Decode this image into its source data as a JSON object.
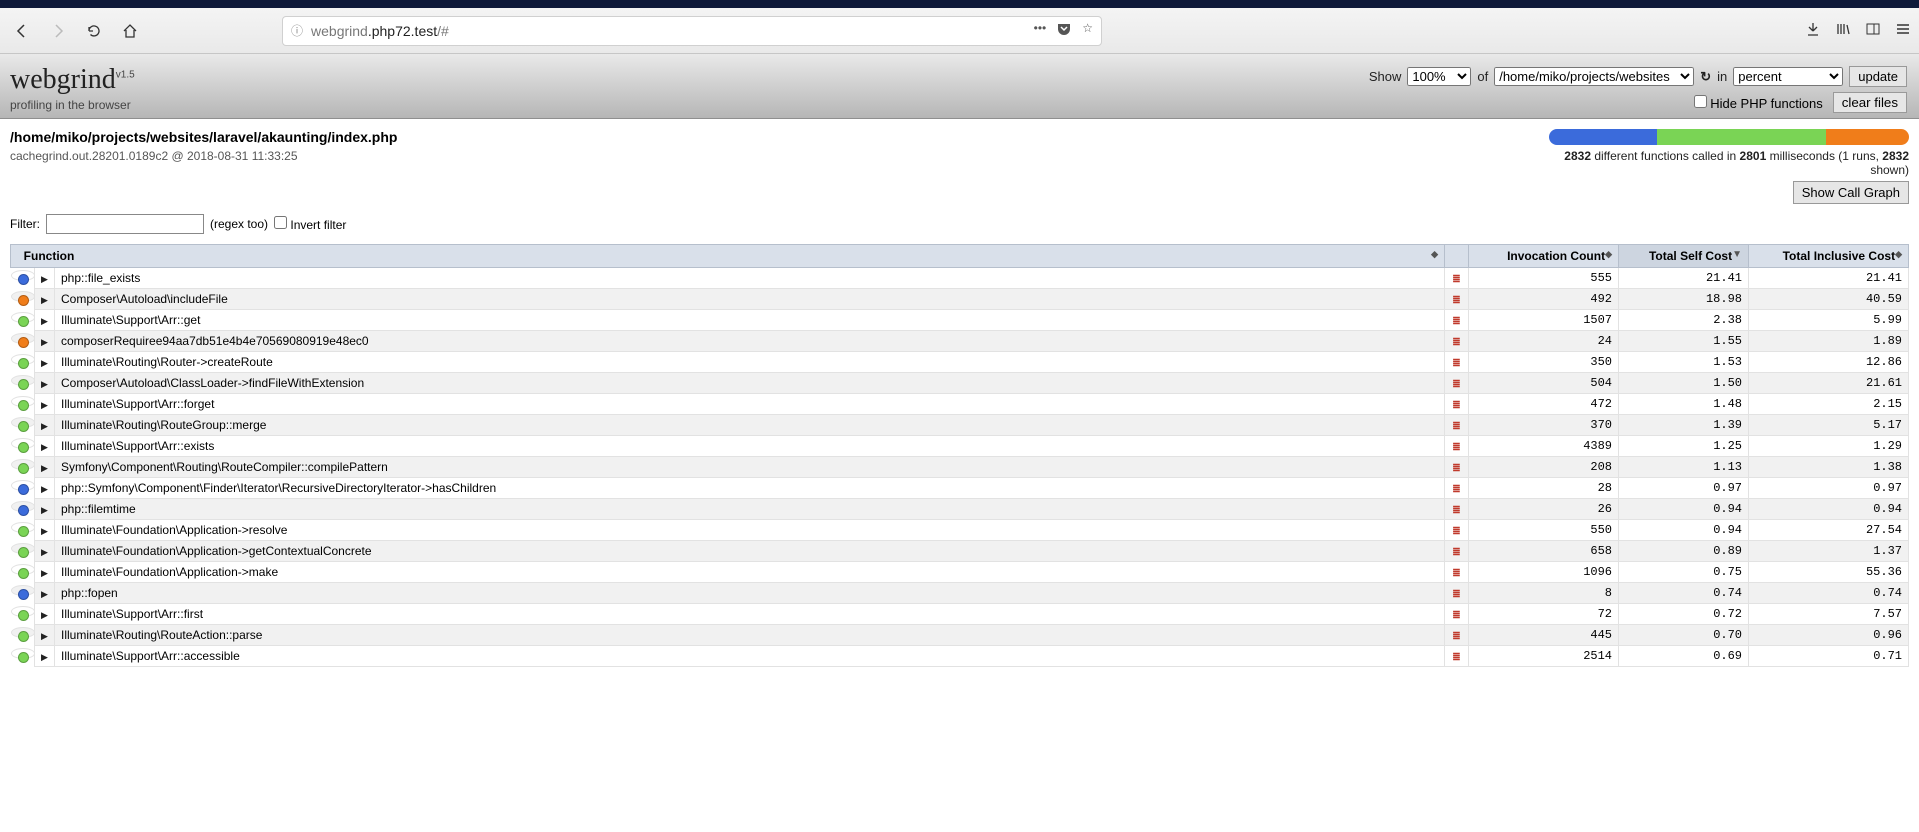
{
  "browser": {
    "url_grey_prefix": "webgrind",
    "url_bold_mid": ".php72.test",
    "url_grey_suffix": "/#"
  },
  "app": {
    "title": "webgrind",
    "version": "v1.5",
    "subtitle": "profiling in the browser",
    "show_label": "Show",
    "percent_options": [
      "100%"
    ],
    "percent_selected": "100%",
    "of_label": "of",
    "file_options": [
      "/home/miko/projects/websites"
    ],
    "file_selected": "/home/miko/projects/websites",
    "in_label": "in",
    "format_options": [
      "percent"
    ],
    "format_selected": "percent",
    "update_label": "update",
    "hide_php_label": "Hide PHP functions",
    "clear_files_label": "clear files"
  },
  "info": {
    "path": "/home/miko/projects/websites/laravel/akaunting/index.php",
    "cache_line": "cachegrind.out.28201.0189c2 @ 2018-08-31 11:33:25",
    "bar": {
      "blue": 30,
      "green": 47,
      "orange": 23
    },
    "stats_1": "2832",
    "stats_2": " different functions called in ",
    "stats_3": "2801",
    "stats_4": " milliseconds (1 runs, ",
    "stats_5": "2832",
    "stats_6": " shown)",
    "call_graph_label": "Show Call Graph"
  },
  "filter": {
    "label": "Filter:",
    "value": "",
    "regex_hint": "(regex too)",
    "invert_label": "Invert filter"
  },
  "columns": {
    "func": "Function",
    "invocation": "Invocation Count",
    "self": "Total Self Cost",
    "inclusive": "Total Inclusive Cost"
  },
  "rows": [
    {
      "color": "blue",
      "fn": "php::file_exists",
      "inv": "555",
      "self": "21.41",
      "inc": "21.41"
    },
    {
      "color": "orange",
      "fn": "Composer\\Autoload\\includeFile",
      "inv": "492",
      "self": "18.98",
      "inc": "40.59"
    },
    {
      "color": "green",
      "fn": "Illuminate\\Support\\Arr::get",
      "inv": "1507",
      "self": "2.38",
      "inc": "5.99"
    },
    {
      "color": "orange",
      "fn": "composerRequiree94aa7db51e4b4e70569080919e48ec0",
      "inv": "24",
      "self": "1.55",
      "inc": "1.89"
    },
    {
      "color": "green",
      "fn": "Illuminate\\Routing\\Router->createRoute",
      "inv": "350",
      "self": "1.53",
      "inc": "12.86"
    },
    {
      "color": "green",
      "fn": "Composer\\Autoload\\ClassLoader->findFileWithExtension",
      "inv": "504",
      "self": "1.50",
      "inc": "21.61"
    },
    {
      "color": "green",
      "fn": "Illuminate\\Support\\Arr::forget",
      "inv": "472",
      "self": "1.48",
      "inc": "2.15"
    },
    {
      "color": "green",
      "fn": "Illuminate\\Routing\\RouteGroup::merge",
      "inv": "370",
      "self": "1.39",
      "inc": "5.17"
    },
    {
      "color": "green",
      "fn": "Illuminate\\Support\\Arr::exists",
      "inv": "4389",
      "self": "1.25",
      "inc": "1.29"
    },
    {
      "color": "green",
      "fn": "Symfony\\Component\\Routing\\RouteCompiler::compilePattern",
      "inv": "208",
      "self": "1.13",
      "inc": "1.38"
    },
    {
      "color": "blue",
      "fn": "php::Symfony\\Component\\Finder\\Iterator\\RecursiveDirectoryIterator->hasChildren",
      "inv": "28",
      "self": "0.97",
      "inc": "0.97"
    },
    {
      "color": "blue",
      "fn": "php::filemtime",
      "inv": "26",
      "self": "0.94",
      "inc": "0.94"
    },
    {
      "color": "green",
      "fn": "Illuminate\\Foundation\\Application->resolve",
      "inv": "550",
      "self": "0.94",
      "inc": "27.54"
    },
    {
      "color": "green",
      "fn": "Illuminate\\Foundation\\Application->getContextualConcrete",
      "inv": "658",
      "self": "0.89",
      "inc": "1.37"
    },
    {
      "color": "green",
      "fn": "Illuminate\\Foundation\\Application->make",
      "inv": "1096",
      "self": "0.75",
      "inc": "55.36"
    },
    {
      "color": "blue",
      "fn": "php::fopen",
      "inv": "8",
      "self": "0.74",
      "inc": "0.74"
    },
    {
      "color": "green",
      "fn": "Illuminate\\Support\\Arr::first",
      "inv": "72",
      "self": "0.72",
      "inc": "7.57"
    },
    {
      "color": "green",
      "fn": "Illuminate\\Routing\\RouteAction::parse",
      "inv": "445",
      "self": "0.70",
      "inc": "0.96"
    },
    {
      "color": "green",
      "fn": "Illuminate\\Support\\Arr::accessible",
      "inv": "2514",
      "self": "0.69",
      "inc": "0.71"
    }
  ]
}
